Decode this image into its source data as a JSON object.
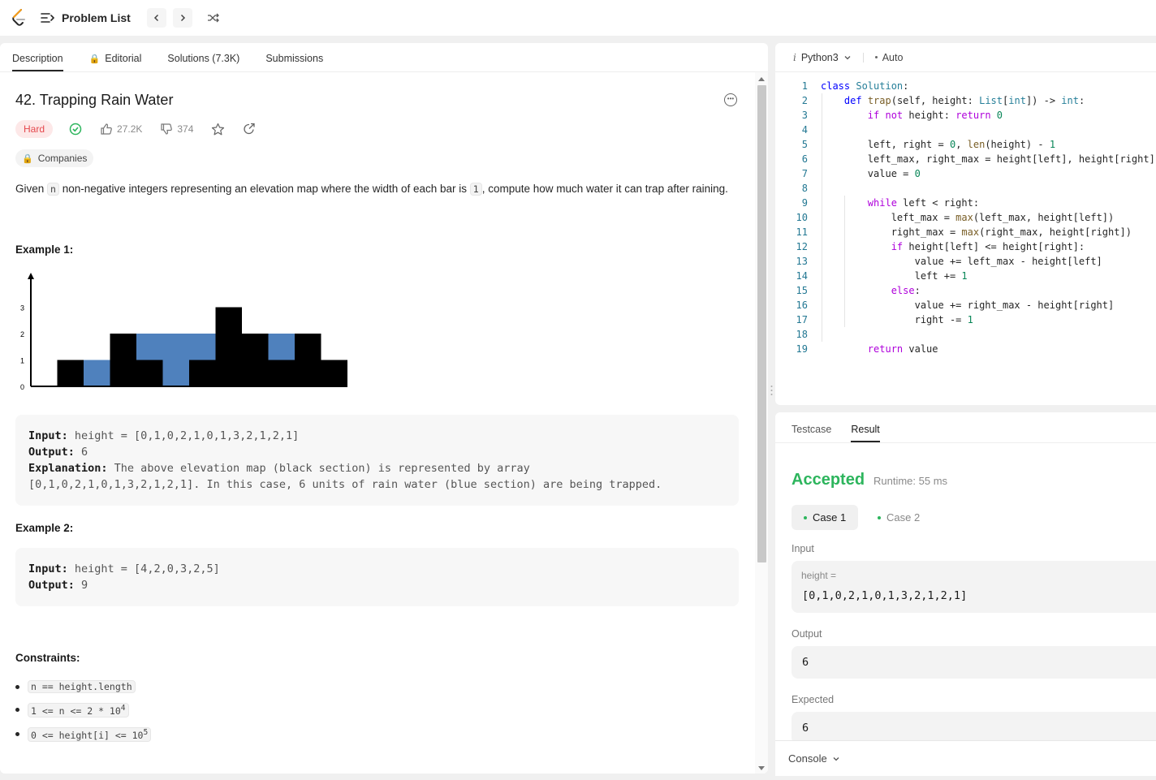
{
  "nav": {
    "problem_list_label": "Problem List",
    "prev_icon": "chevron-left-icon",
    "next_icon": "chevron-right-icon",
    "shuffle_icon": "shuffle-icon"
  },
  "tabs": [
    {
      "label": "Description",
      "active": true
    },
    {
      "label": "Editorial",
      "locked": true
    },
    {
      "label": "Solutions (7.3K)"
    },
    {
      "label": "Submissions"
    }
  ],
  "problem": {
    "title": "42. Trapping Rain Water",
    "difficulty": "Hard",
    "likes": "27.2K",
    "dislikes": "374",
    "companies_label": "Companies",
    "desc_part1": "Given ",
    "desc_code_n": "n",
    "desc_part2": " non-negative integers representing an elevation map where the width of each bar is ",
    "desc_code_1": "1",
    "desc_part3": ", compute how much water it can trap after raining.",
    "example1_title": "Example 1:",
    "example1": {
      "input_label": "Input:",
      "input_value": " height = [0,1,0,2,1,0,1,3,2,1,2,1]",
      "output_label": "Output:",
      "output_value": " 6",
      "explanation_label": "Explanation:",
      "explanation_value": " The above elevation map (black section) is represented by array",
      "explanation_value2": "[0,1,0,2,1,0,1,3,2,1,2,1]. In this case, 6 units of rain water (blue section) are being trapped."
    },
    "example2_title": "Example 2:",
    "example2": {
      "input_label": "Input:",
      "input_value": " height = [4,2,0,3,2,5]",
      "output_label": "Output:",
      "output_value": " 9"
    },
    "constraints_title": "Constraints:",
    "constraints": [
      {
        "text": "n == height.length"
      },
      {
        "text": "1 <= n <= 2 * 10",
        "sup": "4"
      },
      {
        "text": "0 <= height[i] <= 10",
        "sup": "5"
      }
    ]
  },
  "chart_data": {
    "type": "bar",
    "heights": [
      0,
      1,
      0,
      2,
      1,
      0,
      1,
      3,
      2,
      1,
      2,
      1
    ],
    "water": [
      0,
      0,
      1,
      0,
      1,
      2,
      1,
      0,
      0,
      1,
      0,
      0
    ],
    "y_ticks": [
      "0",
      "1",
      "2",
      "3"
    ],
    "bar_color": "#000000",
    "water_color": "#4f81bd"
  },
  "editor": {
    "language": "Python3",
    "mode": "Auto",
    "lines": [
      "class Solution:",
      "    def trap(self, height: List[int]) -> int:",
      "        if not height: return 0",
      "",
      "        left, right = 0, len(height) - 1",
      "        left_max, right_max = height[left], height[right]",
      "        value = 0",
      "",
      "        while left < right:",
      "            left_max = max(left_max, height[left])",
      "            right_max = max(right_max, height[right])",
      "            if height[left] <= height[right]:",
      "                value += left_max - height[left]",
      "                left += 1",
      "            else:",
      "                value += right_max - height[right]",
      "                right -= 1",
      "",
      "        return value"
    ]
  },
  "result": {
    "tab_testcase": "Testcase",
    "tab_result": "Result",
    "status": "Accepted",
    "runtime": "Runtime: 55 ms",
    "case1": "Case 1",
    "case2": "Case 2",
    "input_label": "Input",
    "input_var": "height =",
    "input_value": "[0,1,0,2,1,0,1,3,2,1,2,1]",
    "output_label": "Output",
    "output_value": "6",
    "expected_label": "Expected",
    "expected_value": "6",
    "console_label": "Console"
  },
  "colors": {
    "accent_green": "#2db55d",
    "hard_red": "#e5484d",
    "lock_orange": "#f0a500"
  }
}
